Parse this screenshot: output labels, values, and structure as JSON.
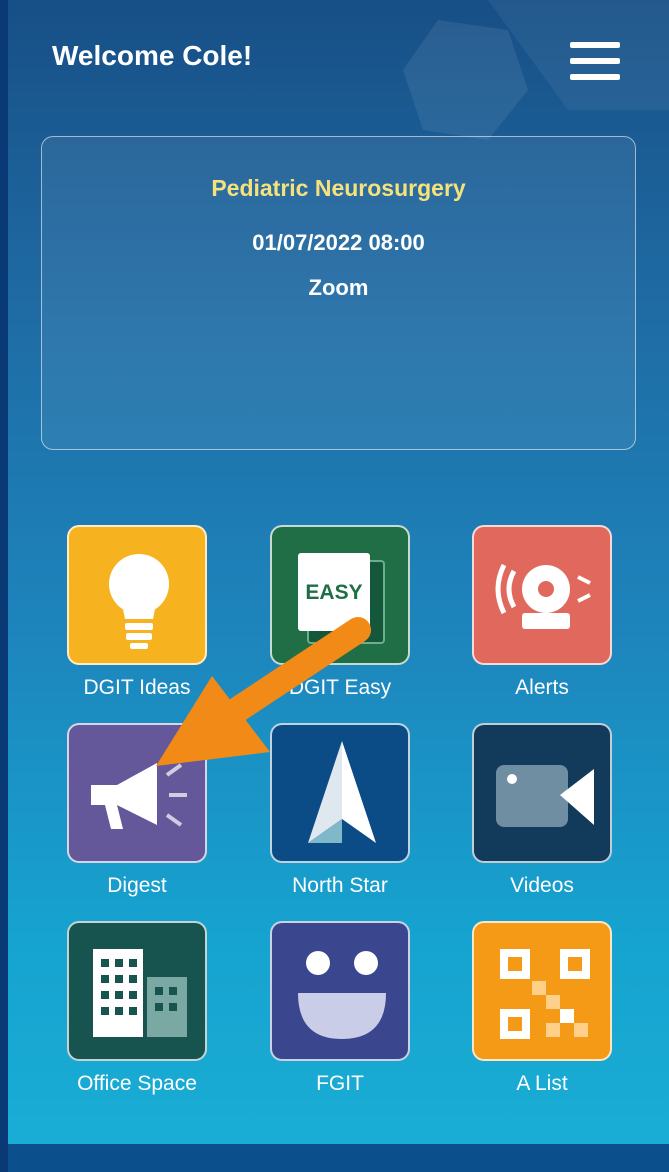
{
  "header": {
    "title": "Welcome Cole!"
  },
  "event": {
    "name": "Pediatric Neurosurgery",
    "datetime": "01/07/2022 08:00",
    "location": "Zoom"
  },
  "apps": [
    {
      "label": "DGIT Ideas",
      "icon": "lightbulb-icon",
      "color": "#f7b21f"
    },
    {
      "label": "DGIT Easy",
      "icon": "easy-book-icon",
      "color": "#1f6e45"
    },
    {
      "label": "Alerts",
      "icon": "alarm-bell-icon",
      "color": "#e0685c"
    },
    {
      "label": "Digest",
      "icon": "megaphone-icon",
      "color": "#64589a"
    },
    {
      "label": "North Star",
      "icon": "north-star-icon",
      "color": "#0b4b86"
    },
    {
      "label": "Videos",
      "icon": "video-camera-icon",
      "color": "#123a5a"
    },
    {
      "label": "Office Space",
      "icon": "office-building-icon",
      "color": "#17534f"
    },
    {
      "label": "FGIT",
      "icon": "smiley-face-icon",
      "color": "#3a478f"
    },
    {
      "label": "A List",
      "icon": "qr-code-icon",
      "color": "#f59a17"
    }
  ],
  "easy_badge": "EASY",
  "annotation": {
    "icon": "orange-arrow-icon",
    "color": "#f28a18"
  }
}
